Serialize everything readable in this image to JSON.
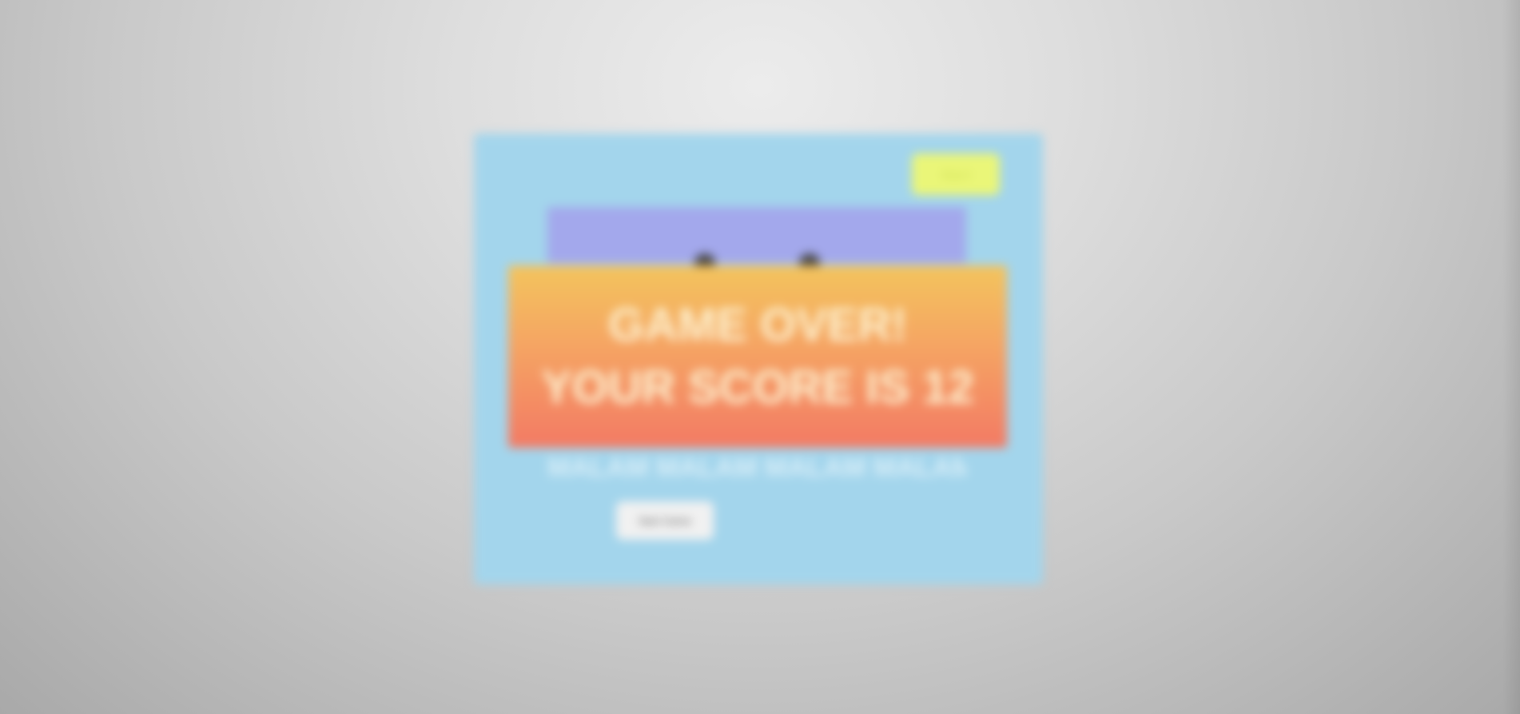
{
  "top_button": {
    "label": "Stop it"
  },
  "lower_text": "MALAM MALAM MALAM MALAM",
  "panel_button": {
    "label": "Start Game"
  },
  "game_over": {
    "line1": "GAME OVER!",
    "line2": "YOUR SCORE IS 12"
  },
  "colors": {
    "panel": "#a3d5ec",
    "player_bar": "#a3a8ec",
    "top_button": "#eaf678",
    "banner_top": "#f3c45d",
    "banner_bottom": "#f37a64",
    "banner_text": "#fdf0cf"
  }
}
